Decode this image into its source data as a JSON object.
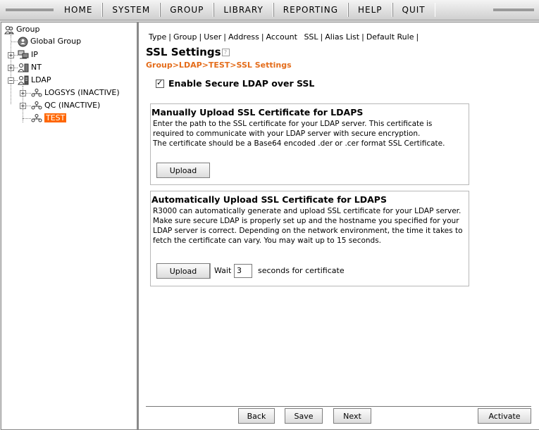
{
  "menu": [
    "HOME",
    "SYSTEM",
    "GROUP",
    "LIBRARY",
    "REPORTING",
    "HELP",
    "QUIT"
  ],
  "tree": {
    "root": "Group",
    "global": "Global Group",
    "ip": "IP",
    "nt": "NT",
    "ldap": "LDAP",
    "logsys": "LOGSYS (INACTIVE)",
    "qc": "QC (INACTIVE)",
    "test": "TEST",
    "expand_plus": "+",
    "expand_minus": "−"
  },
  "tabs": [
    "Type",
    "Group",
    "User",
    "Address",
    "Account",
    "SSL",
    "Alias List",
    "Default Rule"
  ],
  "page": {
    "title": "SSL Settings",
    "help_icon": "?",
    "breadcrumb": "Group>LDAP>TEST>SSL Settings",
    "enable_label": "Enable Secure LDAP over SSL",
    "enable_checked": true
  },
  "manual": {
    "heading": "Manually Upload SSL Certificate for LDAPS",
    "desc": [
      "Enter the path to the SSL certificate for your LDAP server. This certificate is",
      "required to communicate with your LDAP server with secure encryption.",
      "The certificate should be a Base64 encoded .der or .cer format SSL Certificate."
    ],
    "upload": "Upload"
  },
  "auto": {
    "heading": "Automatically Upload SSL Certificate for LDAPS",
    "desc": [
      "R3000 can automatically generate and upload SSL certificate for your LDAP server.",
      "Make sure secure LDAP is properly set up and the hostname you specified for your",
      "LDAP server is correct. Depending on the network environment, the time it takes to",
      "fetch the certificate can vary. You may wait up to 15 seconds."
    ],
    "upload": "Upload",
    "wait": "Wait",
    "wait_value": "3",
    "seconds": "seconds for certificate"
  },
  "footer": {
    "back": "Back",
    "save": "Save",
    "next": "Next",
    "activate": "Activate"
  },
  "colors": {
    "accent": "#ff6600",
    "breadcrumb": "#e46c1a"
  }
}
